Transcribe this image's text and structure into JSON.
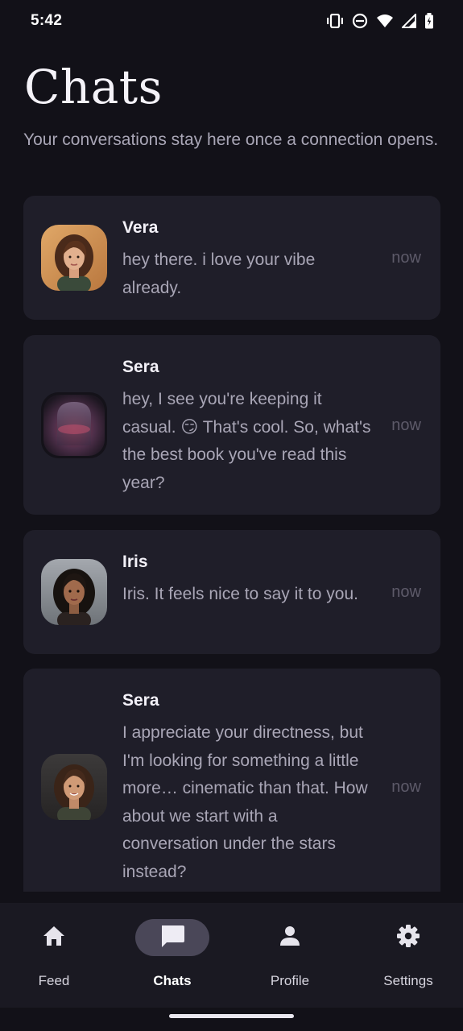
{
  "status_bar": {
    "time": "5:42",
    "icons": [
      "vibrate-icon",
      "do-not-disturb-icon",
      "wifi-icon",
      "signal-icon",
      "battery-icon"
    ]
  },
  "header": {
    "title": "Chats",
    "subtitle": "Your conversations stay here once a connection opens."
  },
  "chats": [
    {
      "name": "Vera",
      "message": "hey there. i love your vibe already.",
      "time": "now"
    },
    {
      "name": "Sera",
      "message": "hey, I see you're keeping it casual. 😏 That's cool. So, what's the best book you've read this year?",
      "time": "now"
    },
    {
      "name": "Iris",
      "message": "Iris. It feels nice to say it to you.",
      "time": "now"
    },
    {
      "name": "Sera",
      "message": "I appreciate your directness, but I'm looking for something a little more… cinematic than that. How about we start with a conversation under the stars instead?",
      "time": "now"
    }
  ],
  "nav": {
    "items": [
      {
        "label": "Feed",
        "icon": "home-icon"
      },
      {
        "label": "Chats",
        "icon": "chat-icon"
      },
      {
        "label": "Profile",
        "icon": "person-icon"
      },
      {
        "label": "Settings",
        "icon": "gear-icon"
      }
    ],
    "active": "Chats"
  },
  "colors": {
    "background": "#121118",
    "card": "#1f1e29",
    "nav": "#1a1922",
    "active_pill": "#4a4758",
    "muted_text": "#a9a6b6"
  }
}
